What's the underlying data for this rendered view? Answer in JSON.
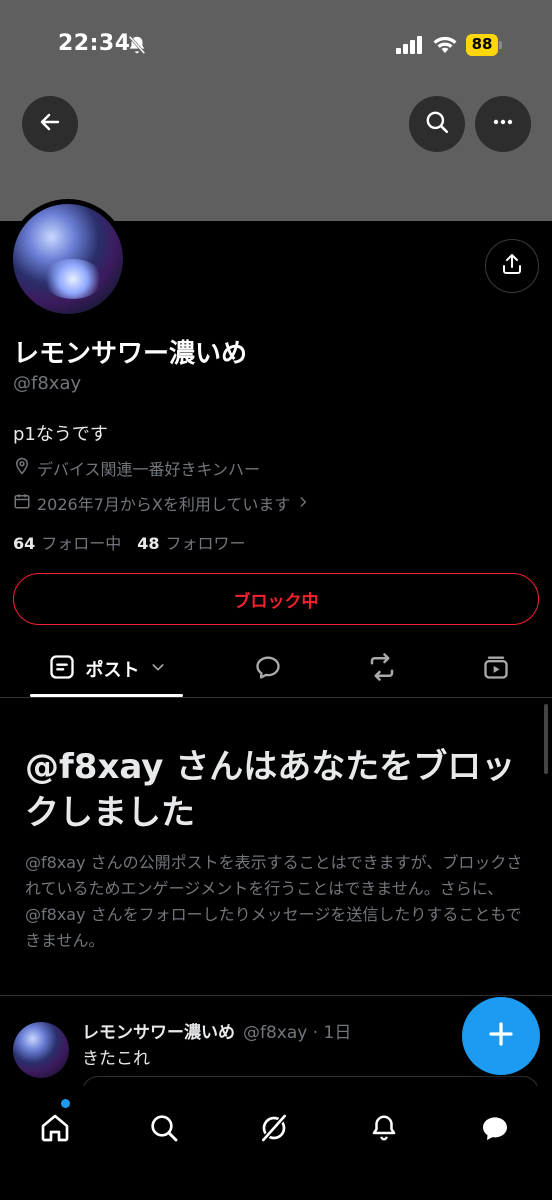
{
  "status_bar": {
    "time": "22:34",
    "battery": "88"
  },
  "profile": {
    "display_name": "レモンサワー濃いめ",
    "handle": "@f8xay",
    "bio": "p1なうです",
    "location": "デバイス関連一番好きキンハー",
    "joined": "2026年7月からXを利用しています",
    "following_count": "64",
    "following_label": "フォロー中",
    "followers_count": "48",
    "followers_label": "フォロワー",
    "block_button": "ブロック中"
  },
  "tabs": {
    "posts_label": "ポスト"
  },
  "blocked_notice": {
    "title": "@f8xay さんはあなたをブロックしました",
    "description": "@f8xay さんの公開ポストを表示することはできますが、ブロックされているためエンゲージメントを行うことはできません。さらに、@f8xay さんをフォローしたりメッセージを送信したりすることもできません。"
  },
  "post": {
    "author_name": "レモンサワー濃いめ",
    "author_meta": "@f8xay · 1日",
    "text": "きたこれ"
  },
  "colors": {
    "accent": "#1d9bf0",
    "block_red": "#f4212e",
    "battery": "#ffd60a",
    "banner": "#5f5f5f"
  },
  "icons": [
    "back-arrow-icon",
    "search-icon",
    "more-icon",
    "share-icon",
    "location-pin-icon",
    "calendar-icon",
    "posts-icon",
    "replies-icon",
    "reposts-icon",
    "media-icon",
    "compose-plus-icon",
    "home-icon",
    "grok-icon",
    "bell-icon",
    "messages-icon"
  ]
}
